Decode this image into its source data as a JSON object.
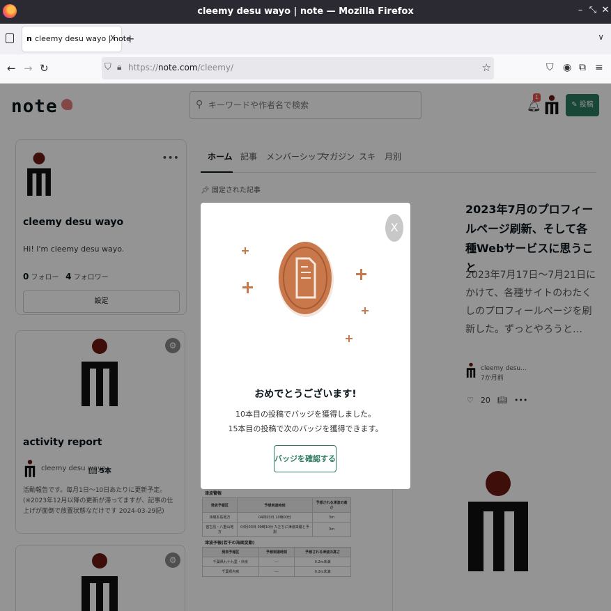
{
  "window": {
    "title": "cleemy desu wayo | note — Mozilla Firefox"
  },
  "tab": {
    "favicon": "n",
    "label": "cleemy desu wayo | note",
    "close": "X"
  },
  "urlbar": {
    "scheme": "https://",
    "domain": "note.com",
    "path": "/cleemy/"
  },
  "header": {
    "logo": "note",
    "search_placeholder": "キーワードや作者名で検索",
    "notification_count": "1",
    "post_label": "投稿"
  },
  "profile": {
    "name": "cleemy desu wayo",
    "bio": "Hi! I'm cleemy desu wayo.",
    "follow_count": "0",
    "follow_label": "フォロー",
    "follower_count": "4",
    "follower_label": "フォロワー",
    "settings_label": "設定"
  },
  "magazine": {
    "title": "activity report",
    "author": "cleemy desu wayo",
    "count": "5本",
    "description": "活動報告です。毎月1日〜10日あたりに更新予定。(※2023年12月以降の更新が滞ってますが、記事の仕上げが面倒で放置状態なだけです 2024-03-29記)"
  },
  "content_tabs": [
    "ホーム",
    "記事",
    "メンバーシップ",
    "マガジン",
    "スキ",
    "月別"
  ],
  "pinned_label": "固定された記事",
  "article": {
    "title": "2023年7月のプロフィールページ刷新、そして各種Webサービスに思うこと",
    "excerpt": "2023年7月17日〜7月21日にかけて、各種サイトのわたくしのプロフィールページを刷新した。ずっとやろうと…",
    "author": "cleemy desu…",
    "time": "7か月前",
    "likes": "20"
  },
  "thumbnail": {
    "table1_label": "津波警報",
    "table1_headers": [
      "発表予報区",
      "予想到達時刻",
      "予想される津波の高さ"
    ],
    "table1_rows": [
      [
        "沖縄本島地方",
        "04月03日 10時00分",
        "3m"
      ],
      [
        "宮古島・八重山地方",
        "04月03日 09時10分 ただちに津波来襲と予測",
        "3m"
      ]
    ],
    "table2_label": "津波予報(若干の海面変動)",
    "table2_headers": [
      "発表予報区",
      "予想到達時刻",
      "予想される津波の高さ"
    ],
    "table2_rows": [
      [
        "千葉県九十九里・外房",
        "---",
        "0.2m未満"
      ],
      [
        "千葉県内房",
        "---",
        "0.2m未満"
      ]
    ]
  },
  "modal": {
    "close": "X",
    "heading": "おめでとうございます!",
    "message_line1": "10本目の投稿でバッジを獲得しました。",
    "message_line2": "15本目の投稿で次のバッジを獲得できます。",
    "button_label": "バッジを確認する"
  },
  "colors": {
    "accent": "#2c7a5f",
    "badge": "#c8784a",
    "logo_red": "#6b1a12"
  }
}
